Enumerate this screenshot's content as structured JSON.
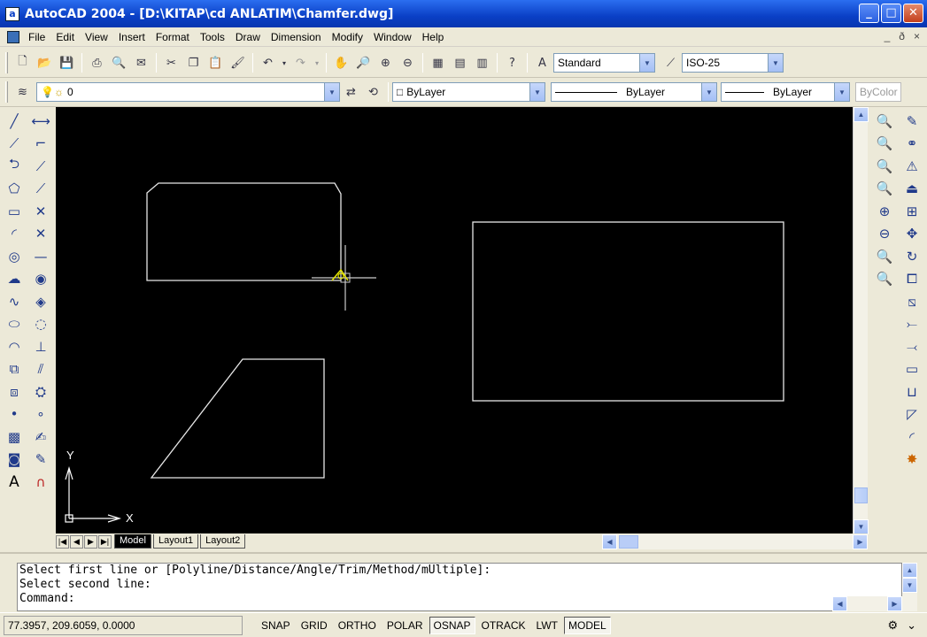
{
  "window": {
    "app_icon_glyph": "a",
    "title": "AutoCAD 2004 - [D:\\KITAP\\cd ANLATIM\\Chamfer.dwg]",
    "minimize": "_",
    "maximize": "□",
    "close": "✕"
  },
  "menu": {
    "items": [
      "File",
      "Edit",
      "View",
      "Insert",
      "Format",
      "Tools",
      "Draw",
      "Dimension",
      "Modify",
      "Window",
      "Help"
    ],
    "mdi_min": "_",
    "mdi_restore": "ð",
    "mdi_close": "×"
  },
  "toolbar_standard": {
    "icons": [
      "new-icon",
      "open-icon",
      "save-icon",
      "print-icon",
      "preview-icon",
      "publish-icon",
      "cut-icon",
      "copy-icon",
      "paste-icon",
      "match-properties-icon",
      "undo-icon",
      "redo-icon",
      "pan-icon",
      "zoom-realtime-icon",
      "zoom-window-icon",
      "zoom-previous-icon",
      "properties-icon",
      "design-center-icon",
      "tool-palettes-icon",
      "help-icon"
    ],
    "text_style_value": "Standard",
    "dim_style_value": "ISO-25"
  },
  "toolbar_layers": {
    "layer_value": "0",
    "color_value": "ByLayer",
    "linetype_value": "ByLayer",
    "lineweight_value": "ByLayer",
    "plotstyle_value": "ByColor"
  },
  "draw_toolbar": {
    "icons": [
      "line-icon",
      "construction-line-icon",
      "polyline-icon",
      "polygon-icon",
      "rectangle-icon",
      "arc-icon",
      "circle-icon",
      "revision-cloud-icon",
      "spline-icon",
      "ellipse-icon",
      "ellipse-arc-icon",
      "insert-block-icon",
      "make-block-icon",
      "point-icon",
      "hatch-icon",
      "region-icon",
      "multiline-text-icon"
    ],
    "text_glyph": "A"
  },
  "dimension_toolbar": {
    "icons": [
      "linear-dim-icon",
      "aligned-dim-icon",
      "ordinate-dim-icon",
      "radius-dim-icon",
      "diameter-dim-icon",
      "angular-dim-icon",
      "quick-dim-icon",
      "baseline-dim-icon",
      "continue-dim-icon",
      "quick-leader-icon",
      "tolerance-icon",
      "center-mark-icon",
      "dim-edit-icon",
      "dim-text-edit-icon",
      "dim-update-icon",
      "dim-style-icon",
      "magnet-icon"
    ]
  },
  "zoom_toolbar": {
    "icons": [
      "zoom-window-icon",
      "zoom-dynamic-icon",
      "zoom-scale-icon",
      "zoom-center-icon",
      "zoom-in-icon",
      "zoom-out-icon",
      "zoom-all-icon",
      "zoom-extents-icon"
    ]
  },
  "modify_toolbar": {
    "icons": [
      "erase-icon",
      "copy-object-icon",
      "mirror-icon",
      "offset-icon",
      "array-icon",
      "move-icon",
      "rotate-icon",
      "scale-icon",
      "stretch-icon",
      "trim-icon",
      "extend-icon",
      "break-icon",
      "join-icon",
      "chamfer-icon",
      "fillet-icon",
      "explode-icon"
    ]
  },
  "canvas": {
    "ucs_x_label": "X",
    "ucs_y_label": "Y"
  },
  "tabs": {
    "nav": [
      "|◀",
      "◀",
      "▶",
      "▶|"
    ],
    "items": [
      {
        "label": "Model",
        "active": true
      },
      {
        "label": "Layout1",
        "active": false
      },
      {
        "label": "Layout2",
        "active": false
      }
    ]
  },
  "command": {
    "lines": [
      "Select first line or [Polyline/Distance/Angle/Trim/Method/mUltiple]:",
      "Select second line:",
      "Command:"
    ]
  },
  "status": {
    "coordinates": "77.3957, 209.6059, 0.0000",
    "buttons": [
      {
        "label": "SNAP",
        "pressed": false
      },
      {
        "label": "GRID",
        "pressed": false
      },
      {
        "label": "ORTHO",
        "pressed": false
      },
      {
        "label": "POLAR",
        "pressed": false
      },
      {
        "label": "OSNAP",
        "pressed": true
      },
      {
        "label": "OTRACK",
        "pressed": false
      },
      {
        "label": "LWT",
        "pressed": false
      },
      {
        "label": "MODEL",
        "pressed": true
      }
    ]
  },
  "colors": {
    "canvas_bg": "#000000",
    "geometry": "#e8e8e8",
    "cursor": "#cccccc",
    "snap_marker": "#e5e500",
    "titlebar": "#0a3fc5"
  }
}
